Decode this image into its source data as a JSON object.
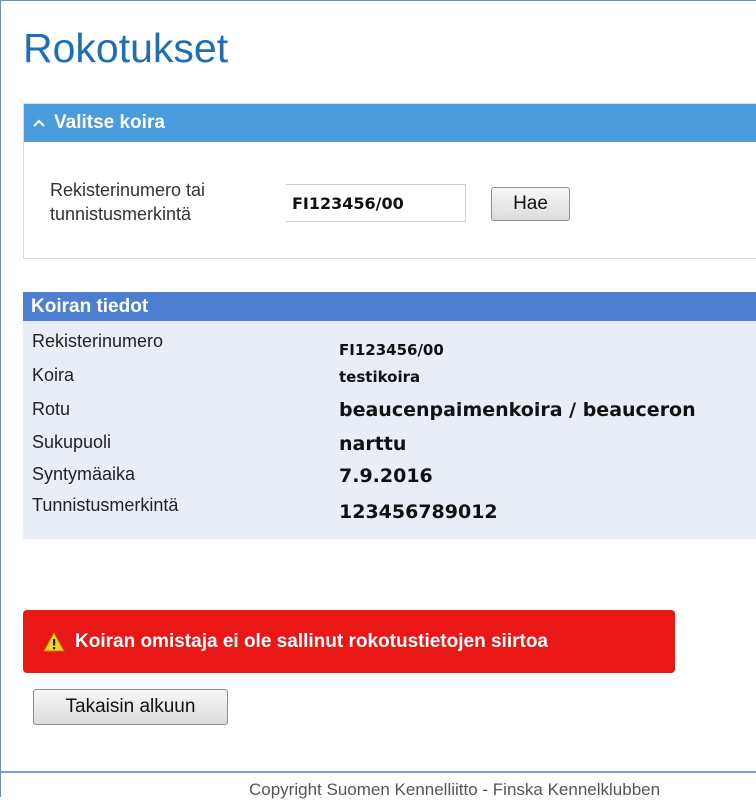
{
  "page_title": "Rokotukset",
  "select_panel": {
    "header": "Valitse koira",
    "field_label": "Rekisterinumero tai tunnistusmerkintä",
    "input_value": "FI123456/00",
    "search_button": "Hae"
  },
  "info_panel": {
    "header": "Koiran tiedot",
    "rows": [
      {
        "label": "Rekisterinumero",
        "value": "FI123456/00"
      },
      {
        "label": "Koira",
        "value": "testikoira"
      },
      {
        "label": "Rotu",
        "value": "beaucenpaimenkoira / beauceron"
      },
      {
        "label": "Sukupuoli",
        "value": "narttu"
      },
      {
        "label": "Syntymäaika",
        "value": "7.9.2016"
      },
      {
        "label": "Tunnistusmerkintä",
        "value": "123456789012"
      }
    ]
  },
  "alert": {
    "icon": "warning-icon",
    "text": "Koiran omistaja ei ole sallinut rokotustietojen siirtoa",
    "color": "#ea1717"
  },
  "back_button": "Takaisin alkuun",
  "footer": "Copyright Suomen Kennelliitto - Finska Kennelklubben",
  "colors": {
    "title": "#1f6fb4",
    "select_header": "#4a9cdc",
    "info_header": "#4d7fd0",
    "info_background": "#e9eef6"
  }
}
